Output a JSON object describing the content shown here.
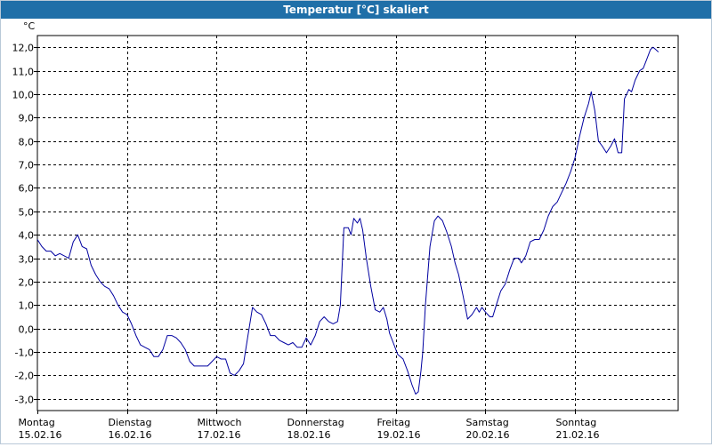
{
  "window": {
    "title": "Temperatur [°C] skaliert"
  },
  "colors": {
    "titlebar": "#1f6fa8",
    "line": "#0000a0",
    "grid": "#000000"
  },
  "chart_data": {
    "type": "line",
    "title": "Temperatur [°C] skaliert",
    "unit": "°C",
    "ylim": [
      -3.5,
      12.5
    ],
    "y_ticks": [
      "-3,0",
      "-2,0",
      "-1,0",
      "0,0",
      "1,0",
      "2,0",
      "3,0",
      "4,0",
      "5,0",
      "6,0",
      "7,0",
      "8,0",
      "9,0",
      "10,0",
      "11,0",
      "12,0"
    ],
    "y_tick_values": [
      -3,
      -2,
      -1,
      0,
      1,
      2,
      3,
      4,
      5,
      6,
      7,
      8,
      9,
      10,
      11,
      12
    ],
    "x_range_days": [
      0,
      7.15
    ],
    "days": [
      {
        "weekday": "Montag",
        "date": "15.02.16"
      },
      {
        "weekday": "Dienstag",
        "date": "16.02.16"
      },
      {
        "weekday": "Mittwoch",
        "date": "17.02.16"
      },
      {
        "weekday": "Donnerstag",
        "date": "18.02.16"
      },
      {
        "weekday": "Freitag",
        "date": "19.02.16"
      },
      {
        "weekday": "Samstag",
        "date": "20.02.16"
      },
      {
        "weekday": "Sonntag",
        "date": "21.02.16"
      }
    ],
    "grid": true,
    "series": [
      {
        "values": [
          [
            0.0,
            3.8
          ],
          [
            0.05,
            3.5
          ],
          [
            0.1,
            3.3
          ],
          [
            0.15,
            3.3
          ],
          [
            0.2,
            3.1
          ],
          [
            0.25,
            3.2
          ],
          [
            0.3,
            3.1
          ],
          [
            0.35,
            3.0
          ],
          [
            0.4,
            3.7
          ],
          [
            0.45,
            4.0
          ],
          [
            0.5,
            3.5
          ],
          [
            0.55,
            3.4
          ],
          [
            0.6,
            2.7
          ],
          [
            0.65,
            2.3
          ],
          [
            0.7,
            2.0
          ],
          [
            0.75,
            1.8
          ],
          [
            0.8,
            1.7
          ],
          [
            0.85,
            1.4
          ],
          [
            0.9,
            1.0
          ],
          [
            0.95,
            0.7
          ],
          [
            1.0,
            0.6
          ],
          [
            1.05,
            0.2
          ],
          [
            1.1,
            -0.3
          ],
          [
            1.15,
            -0.7
          ],
          [
            1.2,
            -0.8
          ],
          [
            1.25,
            -0.9
          ],
          [
            1.3,
            -1.2
          ],
          [
            1.35,
            -1.2
          ],
          [
            1.4,
            -0.9
          ],
          [
            1.45,
            -0.3
          ],
          [
            1.5,
            -0.3
          ],
          [
            1.55,
            -0.4
          ],
          [
            1.6,
            -0.6
          ],
          [
            1.65,
            -0.9
          ],
          [
            1.7,
            -1.4
          ],
          [
            1.75,
            -1.6
          ],
          [
            1.8,
            -1.6
          ],
          [
            1.85,
            -1.6
          ],
          [
            1.9,
            -1.6
          ],
          [
            1.95,
            -1.4
          ],
          [
            2.0,
            -1.2
          ],
          [
            2.05,
            -1.3
          ],
          [
            2.1,
            -1.3
          ],
          [
            2.15,
            -1.9
          ],
          [
            2.2,
            -2.0
          ],
          [
            2.25,
            -1.8
          ],
          [
            2.3,
            -1.5
          ],
          [
            2.35,
            -0.3
          ],
          [
            2.4,
            0.9
          ],
          [
            2.45,
            0.7
          ],
          [
            2.5,
            0.6
          ],
          [
            2.55,
            0.2
          ],
          [
            2.6,
            -0.3
          ],
          [
            2.65,
            -0.3
          ],
          [
            2.7,
            -0.5
          ],
          [
            2.75,
            -0.6
          ],
          [
            2.8,
            -0.7
          ],
          [
            2.85,
            -0.6
          ],
          [
            2.9,
            -0.8
          ],
          [
            2.95,
            -0.8
          ],
          [
            3.0,
            -0.4
          ],
          [
            3.05,
            -0.7
          ],
          [
            3.1,
            -0.3
          ],
          [
            3.15,
            0.3
          ],
          [
            3.2,
            0.5
          ],
          [
            3.25,
            0.3
          ],
          [
            3.3,
            0.2
          ],
          [
            3.35,
            0.3
          ],
          [
            3.38,
            1.0
          ],
          [
            3.42,
            4.3
          ],
          [
            3.47,
            4.3
          ],
          [
            3.5,
            4.0
          ],
          [
            3.53,
            4.7
          ],
          [
            3.57,
            4.5
          ],
          [
            3.6,
            4.7
          ],
          [
            3.63,
            4.2
          ],
          [
            3.67,
            3.0
          ],
          [
            3.72,
            1.8
          ],
          [
            3.77,
            0.8
          ],
          [
            3.82,
            0.7
          ],
          [
            3.86,
            0.9
          ],
          [
            3.9,
            0.4
          ],
          [
            3.93,
            -0.2
          ],
          [
            3.97,
            -0.6
          ],
          [
            4.02,
            -1.1
          ],
          [
            4.08,
            -1.3
          ],
          [
            4.13,
            -1.8
          ],
          [
            4.18,
            -2.4
          ],
          [
            4.22,
            -2.8
          ],
          [
            4.25,
            -2.7
          ],
          [
            4.28,
            -1.8
          ],
          [
            4.3,
            -1.0
          ],
          [
            4.33,
            1.0
          ],
          [
            4.38,
            3.5
          ],
          [
            4.43,
            4.6
          ],
          [
            4.47,
            4.8
          ],
          [
            4.52,
            4.6
          ],
          [
            4.57,
            4.1
          ],
          [
            4.62,
            3.5
          ],
          [
            4.66,
            2.8
          ],
          [
            4.7,
            2.3
          ],
          [
            4.75,
            1.4
          ],
          [
            4.8,
            0.4
          ],
          [
            4.85,
            0.6
          ],
          [
            4.9,
            0.9
          ],
          [
            4.93,
            0.7
          ],
          [
            4.96,
            0.9
          ],
          [
            5.0,
            0.7
          ],
          [
            5.05,
            0.5
          ],
          [
            5.08,
            0.5
          ],
          [
            5.12,
            1.0
          ],
          [
            5.17,
            1.6
          ],
          [
            5.22,
            1.9
          ],
          [
            5.27,
            2.5
          ],
          [
            5.32,
            3.0
          ],
          [
            5.37,
            3.0
          ],
          [
            5.4,
            2.8
          ],
          [
            5.45,
            3.1
          ],
          [
            5.5,
            3.7
          ],
          [
            5.55,
            3.8
          ],
          [
            5.6,
            3.8
          ],
          [
            5.65,
            4.2
          ],
          [
            5.7,
            4.8
          ],
          [
            5.75,
            5.2
          ],
          [
            5.8,
            5.4
          ],
          [
            5.85,
            5.8
          ],
          [
            5.9,
            6.2
          ],
          [
            5.95,
            6.7
          ],
          [
            6.0,
            7.3
          ],
          [
            6.05,
            8.2
          ],
          [
            6.1,
            9.0
          ],
          [
            6.15,
            9.6
          ],
          [
            6.18,
            10.1
          ],
          [
            6.22,
            9.3
          ],
          [
            6.26,
            8.0
          ],
          [
            6.3,
            7.8
          ],
          [
            6.35,
            7.5
          ],
          [
            6.4,
            7.8
          ],
          [
            6.44,
            8.1
          ],
          [
            6.48,
            7.5
          ],
          [
            6.52,
            7.5
          ],
          [
            6.55,
            9.8
          ],
          [
            6.6,
            10.2
          ],
          [
            6.63,
            10.1
          ],
          [
            6.67,
            10.6
          ],
          [
            6.72,
            11.0
          ],
          [
            6.76,
            11.1
          ],
          [
            6.8,
            11.5
          ],
          [
            6.84,
            11.9
          ],
          [
            6.87,
            12.0
          ],
          [
            6.9,
            11.9
          ],
          [
            6.93,
            11.8
          ]
        ]
      }
    ]
  }
}
